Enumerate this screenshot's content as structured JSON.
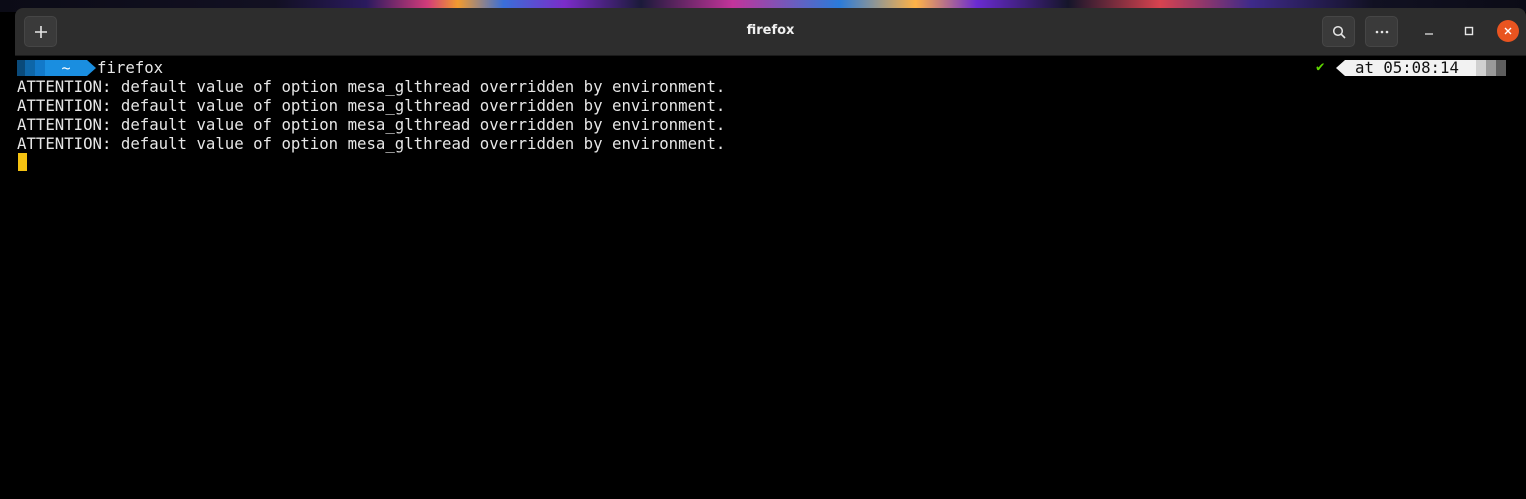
{
  "window": {
    "title": "firefox",
    "accent_close_color": "#e95420"
  },
  "titlebar": {
    "new_tab_icon": "plus-icon",
    "search_icon": "search-icon",
    "menu_icon": "ellipsis-icon",
    "minimize_icon": "minimize-icon",
    "maximize_icon": "maximize-icon",
    "close_icon": "close-icon"
  },
  "prompt": {
    "dir": "~",
    "command": "firefox",
    "status": "✔",
    "time": "at 05:08:14",
    "dir_color": "#1a8ee0",
    "status_color": "#5fd700"
  },
  "output": {
    "lines": [
      "ATTENTION: default value of option mesa_glthread overridden by environment.",
      "ATTENTION: default value of option mesa_glthread overridden by environment.",
      "ATTENTION: default value of option mesa_glthread overridden by environment.",
      "ATTENTION: default value of option mesa_glthread overridden by environment."
    ]
  },
  "cursor": {
    "color": "#f5c211"
  }
}
